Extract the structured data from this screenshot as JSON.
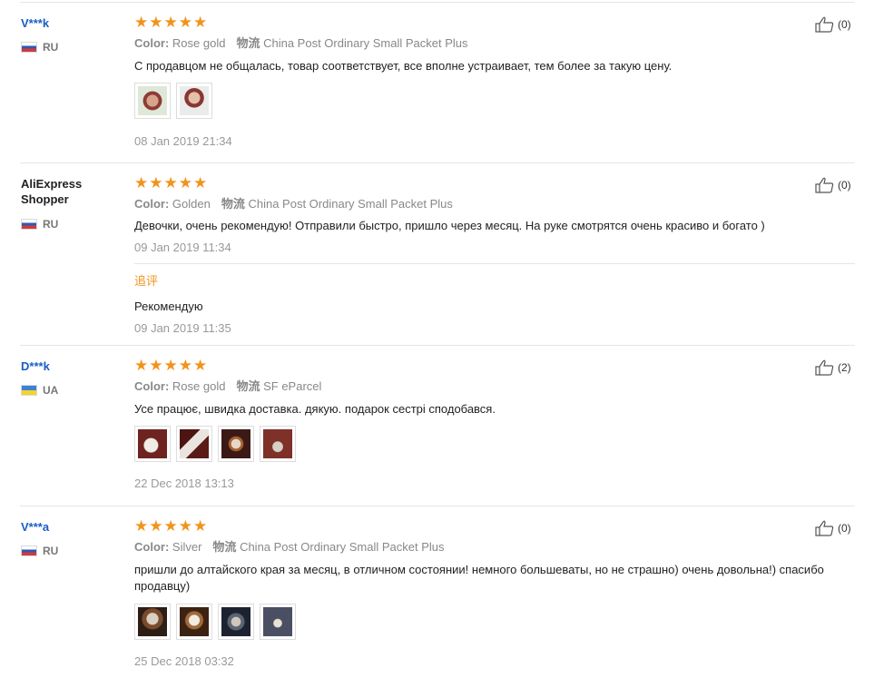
{
  "reviews": [
    {
      "name": "V***k",
      "country": "RU",
      "rating": 5,
      "color_label": "Color:",
      "color_value": "Rose gold",
      "shipping_label": "物流",
      "shipping_value": "China Post Ordinary Small Packet Plus",
      "text": "С продавцом не общалась, товар соответствует, все вполне устраивает, тем более за такую цену.",
      "photo_count": 2,
      "date": "08 Jan 2019 21:34",
      "helpful": "(0)"
    },
    {
      "name": "AliExpress Shopper",
      "country": "RU",
      "rating": 5,
      "color_label": "Color:",
      "color_value": "Golden",
      "shipping_label": "物流",
      "shipping_value": "China Post Ordinary Small Packet Plus",
      "text": "Девочки, очень рекомендую! Отправили быстро, пришло через месяц. На руке смотрятся очень красиво и богато )",
      "date": "09 Jan 2019 11:34",
      "helpful": "(0)",
      "followup": {
        "label": "追评",
        "text": "Рекомендую",
        "date": "09 Jan 2019 11:35"
      }
    },
    {
      "name": "D***k",
      "country": "UA",
      "rating": 5,
      "color_label": "Color:",
      "color_value": "Rose gold",
      "shipping_label": "物流",
      "shipping_value": "SF eParcel",
      "text": "Усе працює, швидка доставка. дякую. подарок сестрі сподобався.",
      "photo_count": 4,
      "date": "22 Dec 2018 13:13",
      "helpful": "(2)"
    },
    {
      "name": "V***a",
      "country": "RU",
      "rating": 5,
      "color_label": "Color:",
      "color_value": "Silver",
      "shipping_label": "物流",
      "shipping_value": "China Post Ordinary Small Packet Plus",
      "text": "пришли до алтайского края за месяц, в отличном состоянии! немного большеваты, но не страшно) очень довольна!) спасибо продавцу)",
      "photo_count": 4,
      "date": "25 Dec 2018 03:32",
      "helpful": "(0)"
    }
  ],
  "icons": {
    "star": "star-icon",
    "thumb": "thumbs-up-icon"
  },
  "colors": {
    "star": "#f2931b",
    "name_link": "#1a5ec6",
    "followup_label": "#f2931b"
  }
}
